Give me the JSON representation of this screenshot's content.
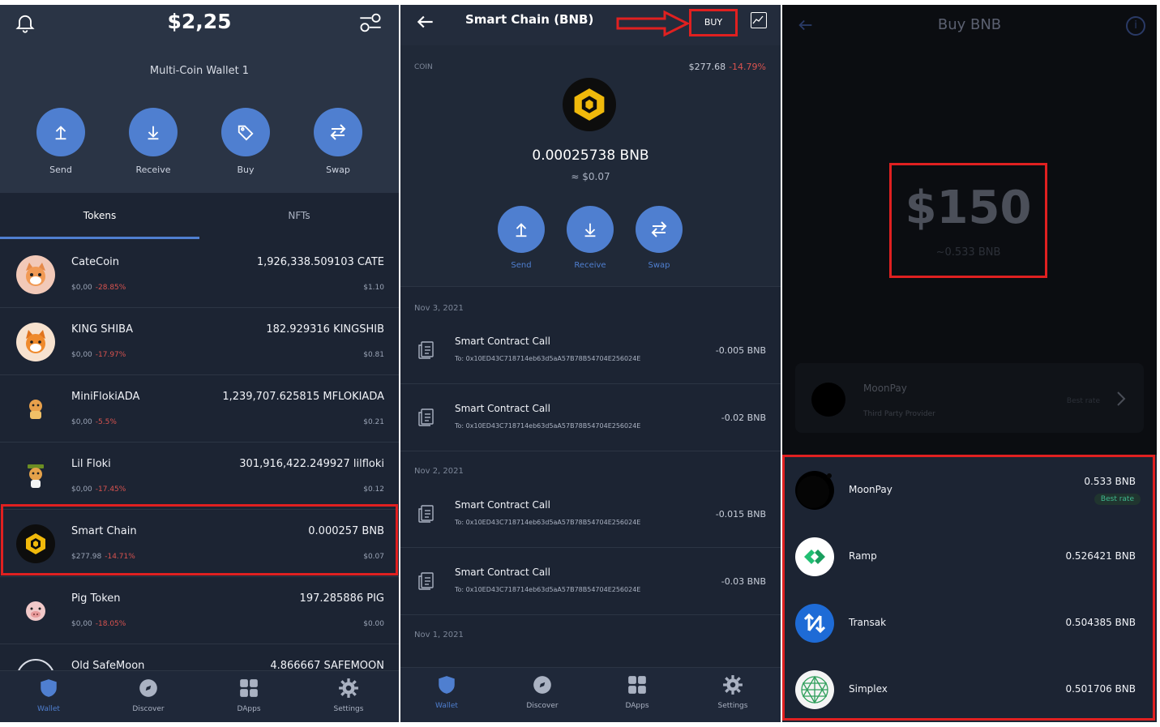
{
  "wallet": {
    "balance": "$2,25",
    "name": "Multi-Coin Wallet 1",
    "actions": [
      "Send",
      "Receive",
      "Buy",
      "Swap"
    ],
    "tabs": [
      "Tokens",
      "NFTs"
    ],
    "tokens": [
      {
        "name": "CateCoin",
        "amount": "1,926,338.509103 CATE",
        "price": "$0,00",
        "change": "-28.85%",
        "fiat": "$1.10",
        "icon": "cat-coin-icon"
      },
      {
        "name": "KING SHIBA",
        "amount": "182.929316 KINGSHIB",
        "price": "$0,00",
        "change": "-17.97%",
        "fiat": "$0.81",
        "icon": "shiba-icon"
      },
      {
        "name": "MiniFlokiADA",
        "amount": "1,239,707.625815 MFLOKIADA",
        "price": "$0,00",
        "change": "-5.5%",
        "fiat": "$0.21",
        "icon": "floki-icon"
      },
      {
        "name": "Lil Floki",
        "amount": "301,916,422.249927 lilfloki",
        "price": "$0,00",
        "change": "-17.45%",
        "fiat": "$0.12",
        "icon": "lil-floki-icon"
      },
      {
        "name": "Smart Chain",
        "amount": "0.000257 BNB",
        "price": "$277.98",
        "change": "-14.71%",
        "fiat": "$0.07",
        "icon": "bnb-icon"
      },
      {
        "name": "Pig Token",
        "amount": "197.285886 PIG",
        "price": "$0,00",
        "change": "-18.05%",
        "fiat": "$0.00",
        "icon": "pig-icon"
      },
      {
        "name": "Old SafeMoon",
        "amount": "4.866667 SAFEMOON",
        "price": "",
        "change": "",
        "fiat": "",
        "icon": "safemoon-icon"
      }
    ],
    "nav": [
      "Wallet",
      "Discover",
      "DApps",
      "Settings"
    ]
  },
  "coin": {
    "title": "Smart Chain (BNB)",
    "buy_label": "BUY",
    "label": "COIN",
    "price": "$277.68",
    "change": "-14.79%",
    "balance": "0.00025738 BNB",
    "fiat": "≈ $0.07",
    "actions": [
      "Send",
      "Receive",
      "Swap"
    ],
    "dates": [
      "Nov 3, 2021",
      "Nov 2, 2021",
      "Nov 1, 2021"
    ],
    "transactions": [
      {
        "title": "Smart Contract Call",
        "to": "To: 0x10ED43C718714eb63d5aA57B78B54704E256024E",
        "amount": "-0.005 BNB"
      },
      {
        "title": "Smart Contract Call",
        "to": "To: 0x10ED43C718714eb63d5aA57B78B54704E256024E",
        "amount": "-0.02 BNB"
      },
      {
        "title": "Smart Contract Call",
        "to": "To: 0x10ED43C718714eb63d5aA57B78B54704E256024E",
        "amount": "-0.015 BNB"
      },
      {
        "title": "Smart Contract Call",
        "to": "To: 0x10ED43C718714eb63d5aA57B78B54704E256024E",
        "amount": "-0.03 BNB"
      }
    ],
    "nav": [
      "Wallet",
      "Discover",
      "DApps",
      "Settings"
    ]
  },
  "buy": {
    "title": "Buy BNB",
    "amount": "$150",
    "amount_sub": "~0.533 BNB",
    "selected_provider": {
      "name": "MoonPay",
      "sub": "Third Party Provider",
      "best": "Best rate"
    },
    "providers": [
      {
        "name": "MoonPay",
        "amount": "0.533 BNB",
        "badge": "Best rate",
        "icon": "moonpay-icon"
      },
      {
        "name": "Ramp",
        "amount": "0.526421 BNB",
        "badge": "",
        "icon": "ramp-icon"
      },
      {
        "name": "Transak",
        "amount": "0.504385 BNB",
        "badge": "",
        "icon": "transak-icon"
      },
      {
        "name": "Simplex",
        "amount": "0.501706 BNB",
        "badge": "",
        "icon": "simplex-icon"
      }
    ]
  },
  "colors": {
    "accent": "#4f7fd0",
    "negative": "#d9534f",
    "highlight": "#e02020",
    "best": "#3fb98f"
  }
}
